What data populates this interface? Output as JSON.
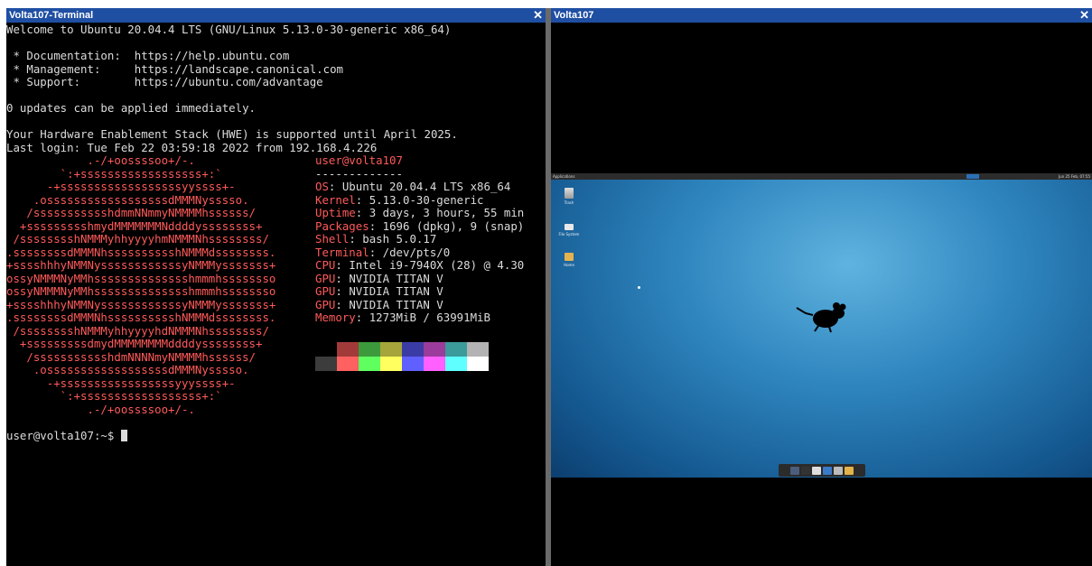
{
  "left_window": {
    "title": "Volta107-Terminal",
    "close": "✕",
    "lines_before": [
      "Welcome to Ubuntu 20.04.4 LTS (GNU/Linux 5.13.0-30-generic x86_64)",
      "",
      " * Documentation:  https://help.ubuntu.com",
      " * Management:     https://landscape.canonical.com",
      " * Support:        https://ubuntu.com/advantage",
      "",
      "0 updates can be applied immediately.",
      "",
      "Your Hardware Enablement Stack (HWE) is supported until April 2025.",
      "Last login: Tue Feb 22 03:59:18 2022 from 192.168.4.226"
    ],
    "ascii_art": [
      "            .-/+oossssoo+/-.",
      "        `:+ssssssssssssssssss+:`",
      "      -+ssssssssssssssssssyyssss+-",
      "    .ossssssssssssssssssdMMMNysssso.",
      "   /ssssssssssshdmmNNmmyNMMMMhssssss/",
      "  +ssssssssshmydMMMMMMMNddddyssssssss+",
      " /sssssssshNMMMyhhyyyyhmNMMMNhssssssss/",
      ".ssssssssdMMMNhsssssssssshNMMMdssssssss.",
      "+sssshhhyNMMNyssssssssssssyNMMMysssssss+",
      "ossyNMMMNyMMhsssssssssssssshmmmhssssssso",
      "ossyNMMMNyMMhsssssssssssssshmmmhssssssso",
      "+sssshhhyNMMNyssssssssssssyNMMMysssssss+",
      ".ssssssssdMMMNhsssssssssshNMMMdssssssss.",
      " /sssssssshNMMMyhhyyyyhdNMMMNhssssssss/",
      "  +sssssssssdmydMMMMMMMMddddyssssssss+",
      "   /ssssssssssshdmNNNNmyNMMMMhssssss/",
      "    .ossssssssssssssssssdMMMNysssso.",
      "      -+sssssssssssssssssyyyssss+-",
      "        `:+ssssssssssssssssss+:`",
      "            .-/+oossssoo+/-."
    ],
    "info": [
      {
        "k": "",
        "v": "user@volta107",
        "header": true
      },
      {
        "k": "",
        "v": "-------------"
      },
      {
        "k": "OS",
        "v": "Ubuntu 20.04.4 LTS x86_64"
      },
      {
        "k": "Kernel",
        "v": "5.13.0-30-generic"
      },
      {
        "k": "Uptime",
        "v": "3 days, 3 hours, 55 min"
      },
      {
        "k": "Packages",
        "v": "1696 (dpkg), 9 (snap)"
      },
      {
        "k": "Shell",
        "v": "bash 5.0.17"
      },
      {
        "k": "Terminal",
        "v": "/dev/pts/0"
      },
      {
        "k": "CPU",
        "v": "Intel i9-7940X (28) @ 4.30"
      },
      {
        "k": "GPU",
        "v": "NVIDIA TITAN V"
      },
      {
        "k": "GPU",
        "v": "NVIDIA TITAN V"
      },
      {
        "k": "GPU",
        "v": "NVIDIA TITAN V"
      },
      {
        "k": "Memory",
        "v": "1273MiB / 63991MiB"
      }
    ],
    "swatches_top": [
      "#000000",
      "#a33a3a",
      "#3c9a3c",
      "#a5a53b",
      "#3b3ba6",
      "#9b3b9b",
      "#3b9a9a",
      "#b3b3b3"
    ],
    "swatches_bottom": [
      "#3c3c3c",
      "#ff6060",
      "#60ff60",
      "#ffff60",
      "#6060ff",
      "#ff60ff",
      "#60ffff",
      "#ffffff"
    ],
    "prompt": "user@volta107:~$ "
  },
  "right_window": {
    "title": "Volta107",
    "close": "✕",
    "desktop": {
      "panel_apps": "Applications",
      "panel_tray": "Jun 25 Feb, 07:55",
      "icons": [
        {
          "label": "Trash",
          "icon": "trash-icon"
        },
        {
          "label": "File System",
          "icon": "drive-icon"
        },
        {
          "label": "Home",
          "icon": "home-folder-icon"
        }
      ],
      "dock_colors": [
        "#4b5d7a",
        "#333333",
        "#dedede",
        "#3a7ac9",
        "#bbbbbb",
        "#e2b34a"
      ]
    }
  }
}
